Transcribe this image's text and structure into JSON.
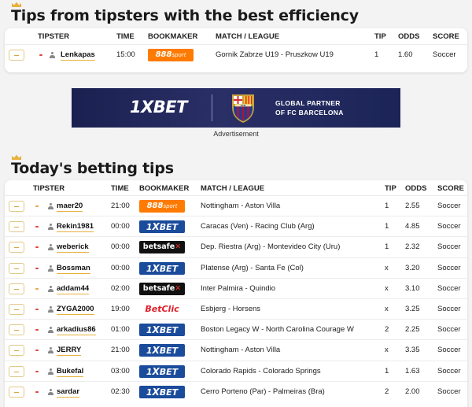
{
  "best_efficiency": {
    "title": "Tips from tipsters with the best efficiency",
    "columns": {
      "tipster": "TIPSTER",
      "time": "TIME",
      "bookmaker": "BOOKMAKER",
      "match": "MATCH / LEAGUE",
      "tip": "TIP",
      "odds": "ODDS",
      "score": "SCORE"
    },
    "rows": [
      {
        "tipster": "Lenkapas",
        "time": "15:00",
        "bookmaker": "888sport",
        "bookmaker_key": "888",
        "match": "Gornik Zabrze U19 - Pruszkow U19",
        "tip": "1",
        "odds": "1.60",
        "sport": "Soccer",
        "marker_color": "#e0433a"
      }
    ]
  },
  "advertisement": {
    "brand": "1XBET",
    "crest_text": "FCB",
    "line1": "GLOBAL PARTNER",
    "line2": "OF FC BARCELONA",
    "caption": "Advertisement"
  },
  "todays_tips": {
    "title": "Today's betting tips",
    "columns": {
      "tipster": "TIPSTER",
      "time": "TIME",
      "bookmaker": "BOOKMAKER",
      "match": "MATCH / LEAGUE",
      "tip": "TIP",
      "odds": "ODDS",
      "score": "SCORE"
    },
    "rows": [
      {
        "tipster": "maer20",
        "time": "21:00",
        "bookmaker": "888sport",
        "bookmaker_key": "888",
        "match": "Nottingham - Aston Villa",
        "tip": "1",
        "odds": "2.55",
        "sport": "Soccer",
        "marker_color": "#e8a53a"
      },
      {
        "tipster": "Rekin1981",
        "time": "00:00",
        "bookmaker": "1XBET",
        "bookmaker_key": "1x",
        "match": "Caracas (Ven) - Racing Club (Arg)",
        "tip": "1",
        "odds": "4.85",
        "sport": "Soccer",
        "marker_color": "#e0433a"
      },
      {
        "tipster": "weberick",
        "time": "00:00",
        "bookmaker": "betsafe",
        "bookmaker_key": "betsafe",
        "match": "Dep. Riestra (Arg) - Montevideo City (Uru)",
        "tip": "1",
        "odds": "2.32",
        "sport": "Soccer",
        "marker_color": "#e0433a"
      },
      {
        "tipster": "Bossman",
        "time": "00:00",
        "bookmaker": "1XBET",
        "bookmaker_key": "1x",
        "match": "Platense (Arg) - Santa Fe (Col)",
        "tip": "x",
        "odds": "3.20",
        "sport": "Soccer",
        "marker_color": "#e0433a"
      },
      {
        "tipster": "addam44",
        "time": "02:00",
        "bookmaker": "betsafe",
        "bookmaker_key": "betsafe",
        "match": "Inter Palmira - Quindio",
        "tip": "x",
        "odds": "3.10",
        "sport": "Soccer",
        "marker_color": "#e8a53a"
      },
      {
        "tipster": "ZYGA2000",
        "time": "19:00",
        "bookmaker": "BetClic",
        "bookmaker_key": "betclic",
        "match": "Esbjerg - Horsens",
        "tip": "x",
        "odds": "3.25",
        "sport": "Soccer",
        "marker_color": "#e0433a"
      },
      {
        "tipster": "arkadius86",
        "time": "01:00",
        "bookmaker": "1XBET",
        "bookmaker_key": "1x",
        "match": "Boston Legacy W - North Carolina Courage W",
        "tip": "2",
        "odds": "2.25",
        "sport": "Soccer",
        "marker_color": "#e0433a"
      },
      {
        "tipster": "JERRY",
        "time": "21:00",
        "bookmaker": "1XBET",
        "bookmaker_key": "1x",
        "match": "Nottingham - Aston Villa",
        "tip": "x",
        "odds": "3.35",
        "sport": "Soccer",
        "marker_color": "#e0433a"
      },
      {
        "tipster": "Bukefal",
        "time": "03:00",
        "bookmaker": "1XBET",
        "bookmaker_key": "1x",
        "match": "Colorado Rapids - Colorado Springs",
        "tip": "1",
        "odds": "1.63",
        "sport": "Soccer",
        "marker_color": "#e0433a"
      },
      {
        "tipster": "sardar",
        "time": "02:30",
        "bookmaker": "1XBET",
        "bookmaker_key": "1x",
        "match": "Cerro Porteno (Par) - Palmeiras (Bra)",
        "tip": "2",
        "odds": "2.00",
        "sport": "Soccer",
        "marker_color": "#e0433a"
      }
    ]
  },
  "colors": {
    "accent_gold": "#e7b13c",
    "bookmaker_888": "#ff7a00",
    "bookmaker_1xbet": "#1b4b9b",
    "bookmaker_betsafe": "#111111",
    "bookmaker_betclic": "#e0202a",
    "ad_background": "#1b2457"
  },
  "icons": {
    "title": "crown-icon",
    "row_action": "star-icon",
    "tipster": "user-icon"
  }
}
